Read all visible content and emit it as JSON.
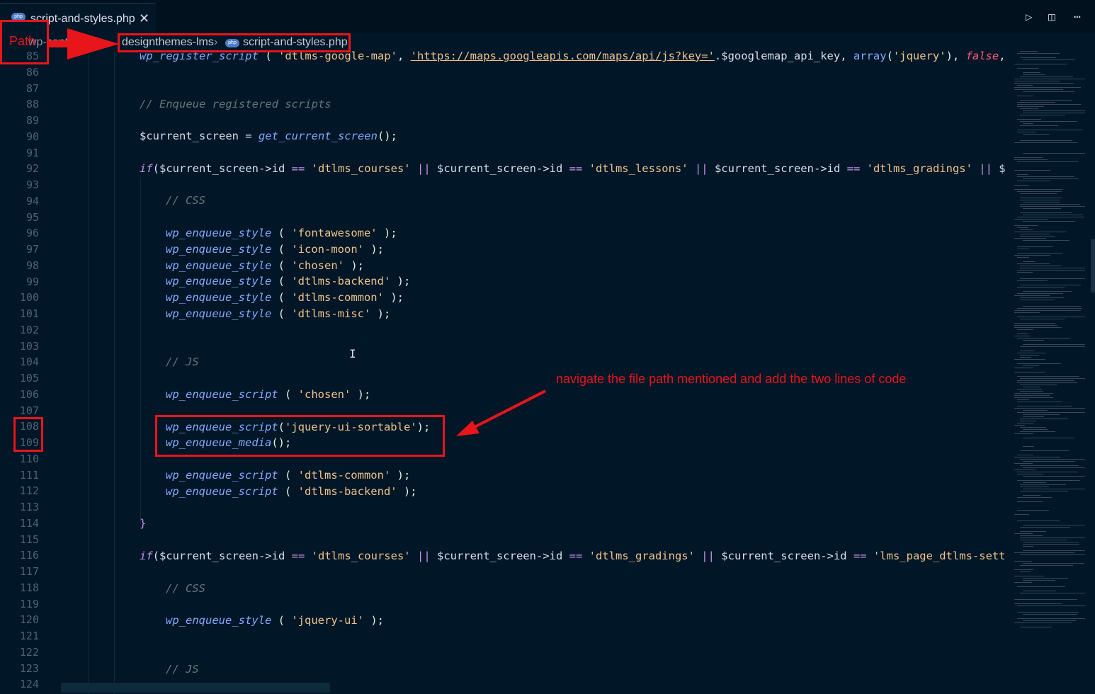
{
  "tab": {
    "badge": "php",
    "title": "script-and-styles.php",
    "close": "✕"
  },
  "breadcrumb": {
    "root": "wp-content",
    "folder": "designthemes-lms",
    "separator": "›",
    "file_badge": "php",
    "file": "script-and-styles.php"
  },
  "toolbar": {
    "run": "▷",
    "split": "◫",
    "more": "⋯"
  },
  "gutter": {
    "line_numbers": [
      "85",
      "86",
      "87",
      "88",
      "89",
      "90",
      "91",
      "92",
      "93",
      "94",
      "95",
      "96",
      "97",
      "98",
      "99",
      "100",
      "101",
      "102",
      "103",
      "104",
      "105",
      "106",
      "107",
      "108",
      "109",
      "110",
      "111",
      "112",
      "113",
      "114",
      "115",
      "116",
      "117",
      "118",
      "119",
      "120",
      "121",
      "122",
      "123",
      "124"
    ]
  },
  "code": {
    "l85": [
      "wp_register_script",
      "( ",
      "'dtlms-google-map'",
      ", ",
      "'https://maps.googleapis.com/maps/api/js?key='",
      ".$googlemap_api_key, ",
      "array",
      "(",
      "'jquery'",
      "), ",
      "false",
      ", t"
    ],
    "l88": "// Enqueue registered scripts",
    "l90": [
      "$current_screen = ",
      "get_current_screen",
      "();"
    ],
    "l92": [
      "if",
      "($current_screen->id ",
      "==",
      "'dtlms_courses'",
      "||",
      " $current_screen->id ",
      "==",
      "'dtlms_lessons'",
      "||",
      " $current_screen->id ",
      "==",
      "'dtlms_gradings'",
      "||",
      " $cu"
    ],
    "l94": "// CSS",
    "l96": [
      "wp_enqueue_style",
      "( ",
      "'fontawesome'",
      " );"
    ],
    "l97": [
      "wp_enqueue_style",
      "( ",
      "'icon-moon'",
      " );"
    ],
    "l98": [
      "wp_enqueue_style",
      "( ",
      "'chosen'",
      " );"
    ],
    "l99": [
      "wp_enqueue_style",
      "( ",
      "'dtlms-backend'",
      " );"
    ],
    "l100": [
      "wp_enqueue_style",
      "( ",
      "'dtlms-common'",
      " );"
    ],
    "l101": [
      "wp_enqueue_style",
      "( ",
      "'dtlms-misc'",
      " );"
    ],
    "l104": "// JS",
    "l106": [
      "wp_enqueue_script",
      "( ",
      "'chosen'",
      " );"
    ],
    "l108": [
      "wp_enqueue_script",
      "(",
      "'jquery-ui-sortable'",
      ");"
    ],
    "l109": [
      "wp_enqueue_media",
      "();"
    ],
    "l111": [
      "wp_enqueue_script",
      "( ",
      "'dtlms-common'",
      " );"
    ],
    "l112": [
      "wp_enqueue_script",
      "( ",
      "'dtlms-backend'",
      " );"
    ],
    "l114": "}",
    "l116": [
      "if",
      "($current_screen->id ",
      "==",
      "'dtlms_courses'",
      "||",
      " $current_screen->id ",
      "==",
      "'dtlms_gradings'",
      "||",
      " $current_screen->id ",
      "==",
      "'lms_page_dtlms-setti"
    ],
    "l118": "// CSS",
    "l120": [
      "wp_enqueue_style",
      "( ",
      "'jquery-ui'",
      " );"
    ],
    "l123": "// JS"
  },
  "annotations": {
    "path_label": "Path",
    "instruction": "navigate the file path mentioned and add the two lines of code",
    "highlight_color": "#e8151b"
  },
  "colors": {
    "background": "#011627",
    "function": "#82aaff",
    "string": "#ecc48d",
    "comment": "#637777",
    "keyword": "#c792ea"
  }
}
